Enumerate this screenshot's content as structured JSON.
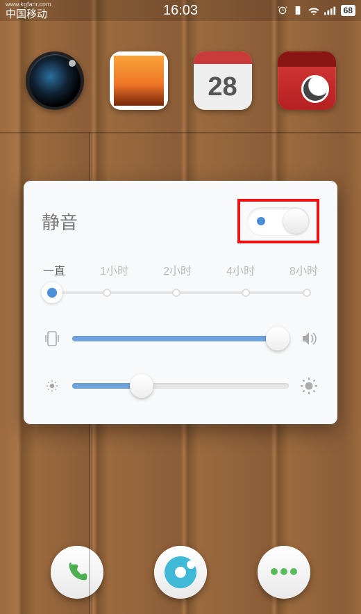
{
  "status": {
    "carrier_url": "www.kgfanr.com",
    "carrier": "中国移动",
    "time": "16:03",
    "battery": "68"
  },
  "home": {
    "calendar_day": "28"
  },
  "popup": {
    "title": "静音",
    "duration_labels": [
      "一直",
      "1小时",
      "2小时",
      "4小时",
      "8小时"
    ],
    "mute_toggle_on": true,
    "duration_selected_index": 0,
    "volume_percent": 95,
    "brightness_percent": 32
  }
}
